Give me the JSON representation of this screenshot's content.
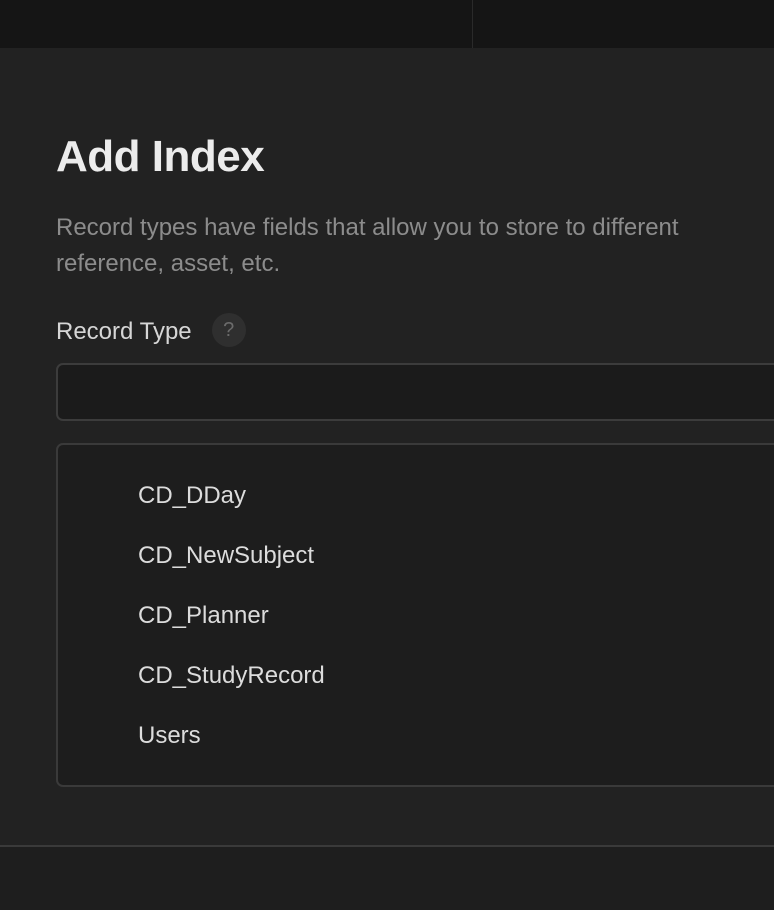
{
  "dialog": {
    "title": "Add Index",
    "description_line1": "Record types have fields that allow you to store to different",
    "description_line2": "reference, asset, etc."
  },
  "record_type": {
    "label": "Record Type",
    "help_glyph": "?",
    "value": "",
    "placeholder": ""
  },
  "options": [
    {
      "label": "CD_DDay"
    },
    {
      "label": "CD_NewSubject"
    },
    {
      "label": "CD_Planner"
    },
    {
      "label": "CD_StudyRecord"
    },
    {
      "label": "Users"
    }
  ]
}
